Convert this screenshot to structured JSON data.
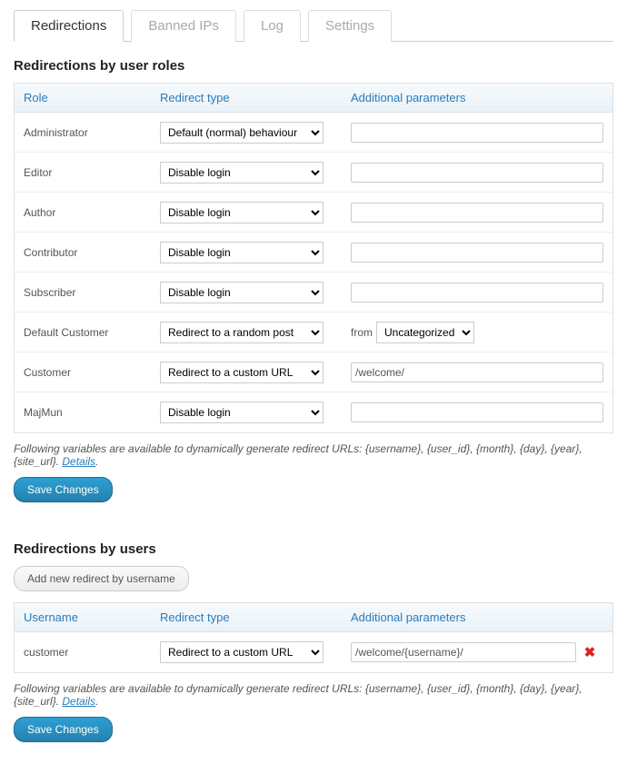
{
  "tabs": [
    {
      "label": "Redirections",
      "active": true
    },
    {
      "label": "Banned IPs",
      "active": false
    },
    {
      "label": "Log",
      "active": false
    },
    {
      "label": "Settings",
      "active": false
    }
  ],
  "section_roles": {
    "title": "Redirections by user roles",
    "headers": {
      "role": "Role",
      "type": "Redirect type",
      "params": "Additional parameters"
    },
    "rows": [
      {
        "role": "Administrator",
        "type": "Default (normal) behaviour",
        "param_mode": "disabled",
        "param_value": ""
      },
      {
        "role": "Editor",
        "type": "Disable login",
        "param_mode": "disabled",
        "param_value": ""
      },
      {
        "role": "Author",
        "type": "Disable login",
        "param_mode": "disabled",
        "param_value": ""
      },
      {
        "role": "Contributor",
        "type": "Disable login",
        "param_mode": "disabled",
        "param_value": ""
      },
      {
        "role": "Subscriber",
        "type": "Disable login",
        "param_mode": "disabled",
        "param_value": ""
      },
      {
        "role": "Default Customer",
        "type": "Redirect to a random post",
        "param_mode": "select",
        "param_select_prefix": "from",
        "param_select_value": "Uncategorized"
      },
      {
        "role": "Customer",
        "type": "Redirect to a custom URL",
        "param_mode": "text",
        "param_value": "/welcome/"
      },
      {
        "role": "MajMun",
        "type": "Disable login",
        "param_mode": "disabled",
        "param_value": ""
      }
    ]
  },
  "section_users": {
    "title": "Redirections by users",
    "add_button": "Add new redirect by username",
    "headers": {
      "username": "Username",
      "type": "Redirect type",
      "params": "Additional parameters"
    },
    "rows": [
      {
        "username": "customer",
        "type": "Redirect to a custom URL",
        "param_value": "/welcome/{username}/"
      }
    ]
  },
  "help_text": "Following variables are available to dynamically generate redirect URLs: {username}, {user_id}, {month}, {day}, {year}, {site_url}. ",
  "help_link": "Details",
  "save_button": "Save Changes"
}
